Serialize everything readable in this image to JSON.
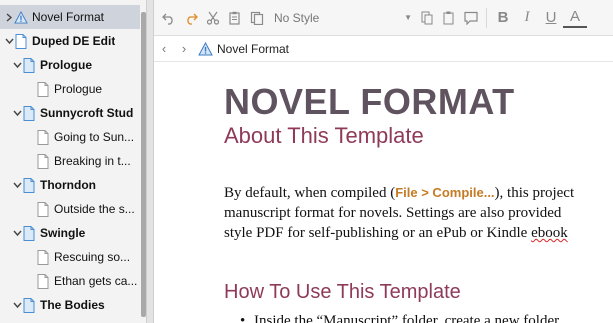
{
  "binder": {
    "items": [
      {
        "label": "Novel Format",
        "type": "info",
        "level": 0,
        "chevron": "right",
        "selected": true,
        "bold": false
      },
      {
        "label": "Duped DE Edit",
        "type": "doc",
        "level": 0,
        "chevron": "down",
        "selected": false,
        "bold": true
      },
      {
        "label": "Prologue",
        "type": "folder-doc",
        "level": 1,
        "chevron": "down",
        "selected": false,
        "bold": true
      },
      {
        "label": "Prologue",
        "type": "page",
        "level": 2,
        "chevron": "",
        "selected": false,
        "bold": false
      },
      {
        "label": "Sunnycroft Stud",
        "type": "folder-doc",
        "level": 1,
        "chevron": "down",
        "selected": false,
        "bold": true
      },
      {
        "label": "Going to Sun...",
        "type": "page",
        "level": 2,
        "chevron": "",
        "selected": false,
        "bold": false
      },
      {
        "label": "Breaking in t...",
        "type": "page",
        "level": 2,
        "chevron": "",
        "selected": false,
        "bold": false
      },
      {
        "label": "Thorndon",
        "type": "folder-doc",
        "level": 1,
        "chevron": "down",
        "selected": false,
        "bold": true
      },
      {
        "label": "Outside the s...",
        "type": "page",
        "level": 2,
        "chevron": "",
        "selected": false,
        "bold": false
      },
      {
        "label": "Swingle",
        "type": "folder-doc",
        "level": 1,
        "chevron": "down",
        "selected": false,
        "bold": true
      },
      {
        "label": "Rescuing so...",
        "type": "page",
        "level": 2,
        "chevron": "",
        "selected": false,
        "bold": false
      },
      {
        "label": "Ethan gets ca...",
        "type": "page",
        "level": 2,
        "chevron": "",
        "selected": false,
        "bold": false
      },
      {
        "label": "The Bodies",
        "type": "folder-doc",
        "level": 1,
        "chevron": "down",
        "selected": false,
        "bold": true
      }
    ]
  },
  "toolbar": {
    "style_value": "No Style",
    "icons": [
      "undo-icon",
      "redo-icon",
      "cut-icon",
      "copy-icon",
      "paste-icon"
    ],
    "format_icons": [
      "bold-icon",
      "italic-icon",
      "underline-icon",
      "text-color-icon"
    ]
  },
  "header": {
    "title": "Novel Format"
  },
  "document": {
    "title": "NOVEL FORMAT",
    "subtitle": "About This Template",
    "para_line1_before": "By default, when compiled (",
    "para_line1_menu": "File > Compile...",
    "para_line1_after": "), this project",
    "para_line2": "manuscript format for novels. Settings are also provided",
    "para_line3_before": "style PDF for self-publishing or an ePub or Kindle ",
    "para_line3_squig": "ebook",
    "heading2": "How To Use This Template",
    "bullet_text": "Inside the “Manuscript” folder, create a new folder"
  },
  "colors": {
    "title": "#5f5360",
    "accent": "#8e3a58",
    "menu_ref": "#c57b25",
    "selection": "#cfd3db",
    "doc_icon": "#4a8fd4"
  }
}
